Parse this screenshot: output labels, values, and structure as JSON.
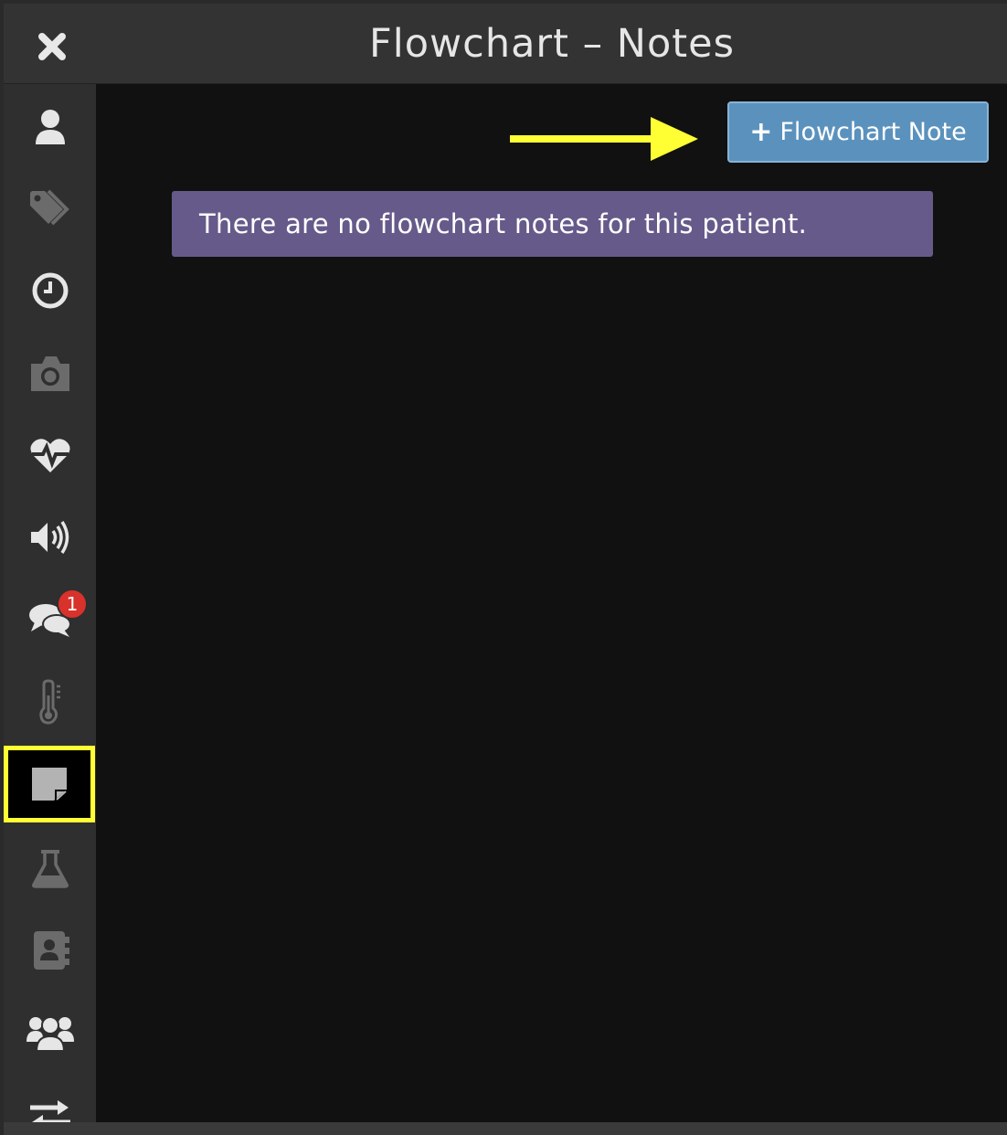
{
  "header": {
    "title": "Flowchart – Notes",
    "close_icon": "close-icon"
  },
  "sidebar": {
    "items": [
      {
        "name": "person-icon",
        "enabled": true
      },
      {
        "name": "tags-icon",
        "enabled": false
      },
      {
        "name": "clock-icon",
        "enabled": true
      },
      {
        "name": "camera-icon",
        "enabled": false
      },
      {
        "name": "heartbeat-icon",
        "enabled": true
      },
      {
        "name": "speaker-icon",
        "enabled": true
      },
      {
        "name": "comments-icon",
        "enabled": true,
        "badge": "1"
      },
      {
        "name": "thermometer-icon",
        "enabled": false
      },
      {
        "name": "sticky-note-icon",
        "enabled": true,
        "active": true
      },
      {
        "name": "flask-icon",
        "enabled": false
      },
      {
        "name": "address-book-icon",
        "enabled": false
      },
      {
        "name": "users-icon",
        "enabled": true
      },
      {
        "name": "exchange-icon",
        "enabled": true
      }
    ]
  },
  "main": {
    "add_button_label": "Flowchart Note",
    "add_button_plus": "+",
    "empty_message": "There are no flowchart notes for this patient."
  },
  "colors": {
    "accent_button": "#5b92bd",
    "message_bg": "#665a8a",
    "highlight": "#ffff33",
    "badge": "#d9312b"
  }
}
